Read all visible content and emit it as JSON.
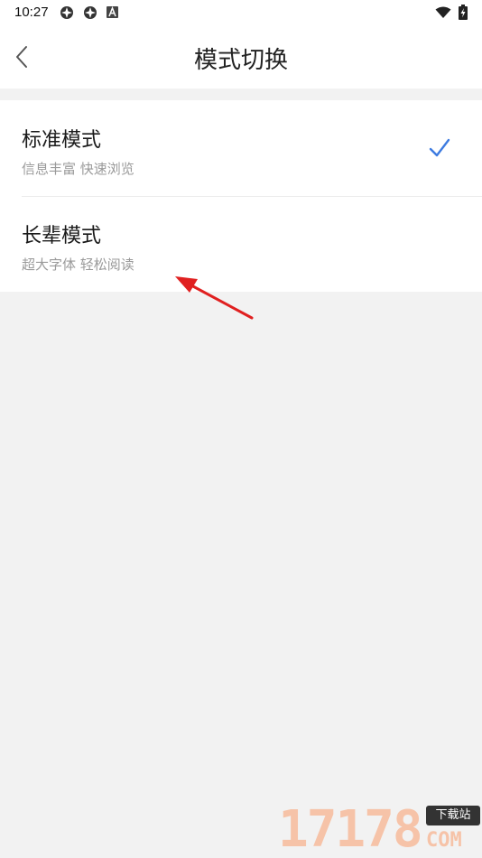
{
  "status_bar": {
    "time": "10:27",
    "left_icons": [
      "app-notification-icon",
      "app-notification-icon",
      "android-a-icon"
    ],
    "right_icons": [
      "wifi-icon",
      "battery-charging-icon"
    ]
  },
  "header": {
    "title": "模式切换",
    "back_icon": "chevron-left-icon"
  },
  "options": [
    {
      "title": "标准模式",
      "subtitle": "信息丰富 快速浏览",
      "selected": true
    },
    {
      "title": "长辈模式",
      "subtitle": "超大字体 轻松阅读",
      "selected": false
    }
  ],
  "colors": {
    "background": "#f2f2f2",
    "card": "#ffffff",
    "check": "#3d7be0",
    "annotation_arrow": "#e02020"
  },
  "watermark": {
    "digits": "17178",
    "badge": "下载站",
    "suffix": "COM"
  }
}
